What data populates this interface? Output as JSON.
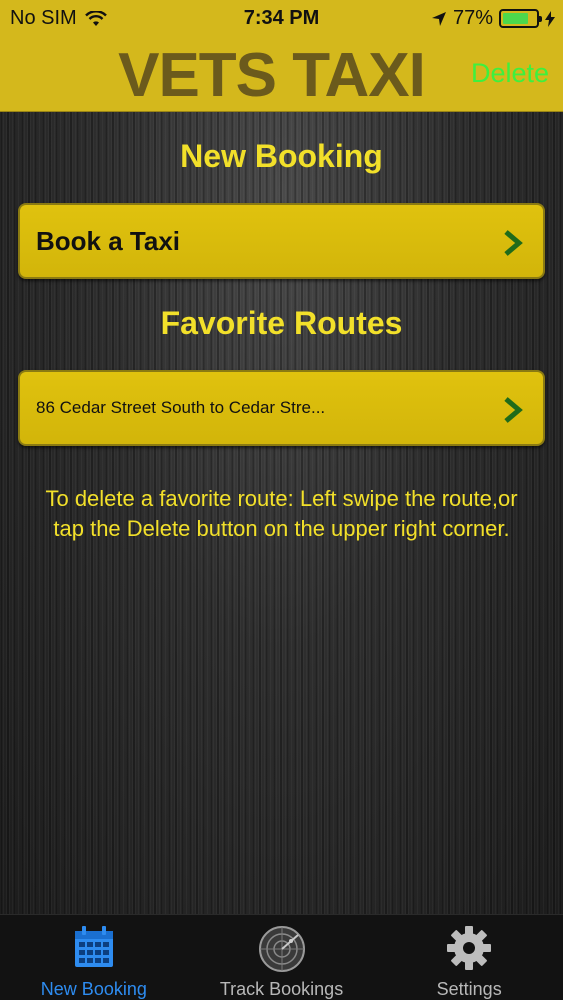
{
  "status_bar": {
    "carrier": "No SIM",
    "time": "7:34 PM",
    "battery": "77%",
    "battery_level": 0.77
  },
  "header": {
    "title": "VETS TAXI",
    "delete_label": "Delete"
  },
  "main": {
    "new_booking_heading": "New Booking",
    "book_taxi_label": "Book a Taxi",
    "favorite_routes_heading": "Favorite Routes",
    "routes": [
      {
        "label": "86 Cedar Street South to Cedar Stre..."
      }
    ],
    "hint_text": "To delete a favorite route: Left swipe the route,or tap the Delete button on the upper right corner."
  },
  "tabbar": {
    "tabs": [
      {
        "label": "New Booking",
        "icon": "calendar-icon",
        "active": true
      },
      {
        "label": "Track Bookings",
        "icon": "radar-icon",
        "active": false
      },
      {
        "label": "Settings",
        "icon": "gear-icon",
        "active": false
      }
    ]
  },
  "colors": {
    "header_bg": "#d4b81c",
    "title_color": "#6b5a1c",
    "delete_color": "#3ef03e",
    "accent_yellow": "#f2e02a",
    "button_yellow": "#dcbd0c",
    "chevron_green": "#1f6b1a",
    "tab_active": "#2e8cf0",
    "battery_green": "#4cd84c"
  }
}
